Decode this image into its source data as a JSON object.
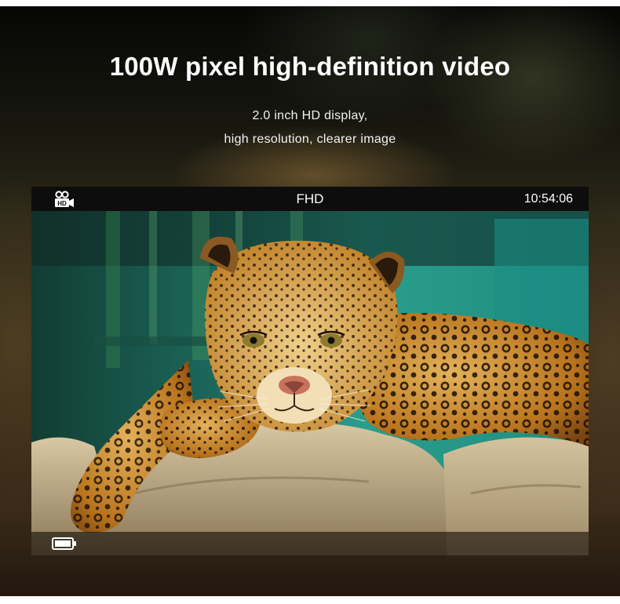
{
  "headline": "100W pixel high-definition video",
  "subtitle_lines": [
    "2.0 inch HD display,",
    "high resolution, clearer image"
  ],
  "screen": {
    "mode_icon": "video-camera-hd-icon",
    "mode_label": "FHD",
    "time": "10:54:06",
    "battery_icon": "battery-full-icon",
    "photo": "jaguar-resting-on-rock"
  },
  "colors": {
    "text": "#ffffff",
    "screen_bar": "#0d0d0d",
    "backdrop_teal": "#1f7d72",
    "fur_orange": "#c9892e"
  }
}
